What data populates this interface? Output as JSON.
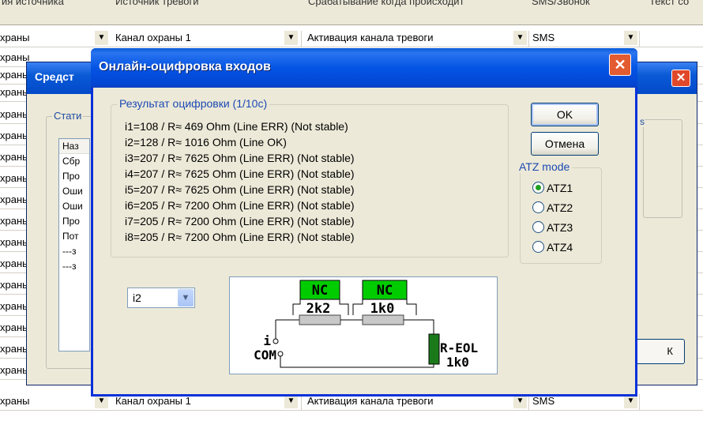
{
  "grid": {
    "headers": [
      "ия источника",
      "Источник тревоги",
      "Срабатывание когда происходит",
      "SMS/Звонок",
      "Текст со"
    ],
    "row_label": "храны",
    "source_value": "Канал охраны 1",
    "trigger_value": "Активация канала тревоги",
    "sms_value": "SMS"
  },
  "back_dialog": {
    "title": "Средст",
    "group_label": "Стати",
    "list_header": "Наз",
    "list_items": [
      "Сбр",
      "Про",
      "Оши",
      "Оши",
      "Про",
      "Пот",
      "---з",
      "---з"
    ],
    "right_group_label": "s",
    "ok_label": "К"
  },
  "dialog": {
    "title": "Онлайн-оцифровка входов",
    "close_label": "✕",
    "result_group_label": "Результат оцифровки (1/10с)",
    "result_lines": [
      "i1=108 / R≈  469 Ohm (Line ERR) (Not stable)",
      "i2=128 / R≈ 1016 Ohm (Line OK)",
      "i3=207 / R≈ 7625 Ohm (Line ERR) (Not stable)",
      "i4=207 / R≈ 7625 Ohm (Line ERR) (Not stable)",
      "i5=207 / R≈ 7625 Ohm (Line ERR) (Not stable)",
      "i6=205 / R≈ 7200 Ohm (Line ERR) (Not stable)",
      "i7=205 / R≈ 7200 Ohm (Line ERR) (Not stable)",
      "i8=205 / R≈ 7200 Ohm (Line ERR) (Not stable)"
    ],
    "ok_label": "OK",
    "cancel_label": "Отмена",
    "atz_group_label": "ATZ mode",
    "atz_options": [
      "ATZ1",
      "ATZ2",
      "ATZ3",
      "ATZ4"
    ],
    "atz_selected": "ATZ1",
    "input_select_value": "i2",
    "diagram": {
      "nc1": "NC",
      "nc2": "NC",
      "r1": "2k2",
      "r2": "1k0",
      "i_label": "i",
      "com_label": "COM",
      "reol_label": "R-EOL",
      "reol_value": "1k0"
    }
  },
  "colors": {
    "title_blue": "#0454e4",
    "close_red": "#e35b30",
    "group_label_blue": "#1c49b3",
    "nc_green": "#00cc00",
    "resistor_grey": "#c8c8c8",
    "reol_green": "#1a7a1a"
  }
}
